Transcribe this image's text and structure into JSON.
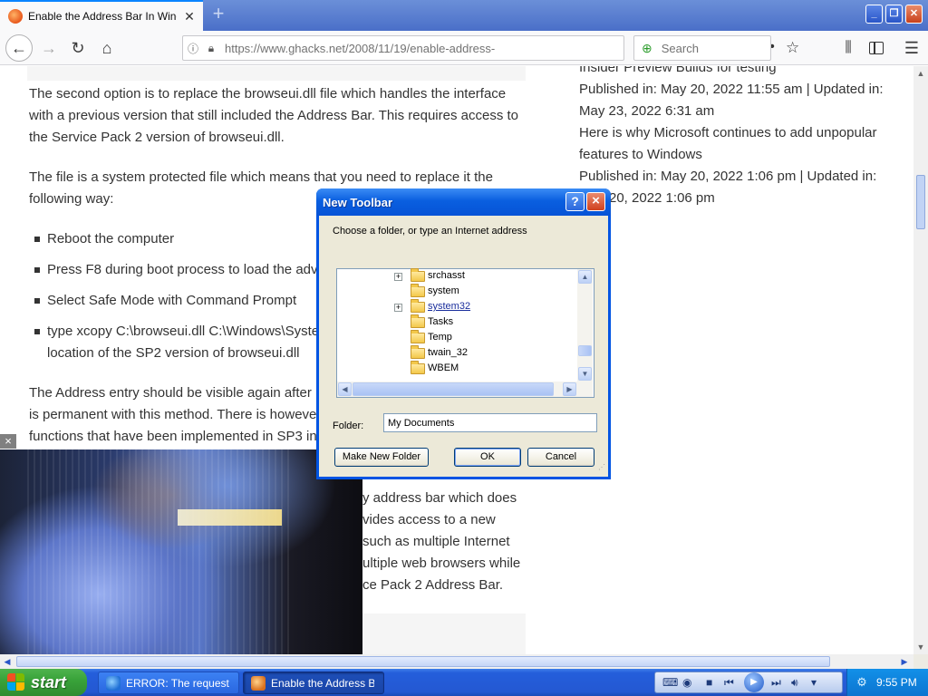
{
  "browser": {
    "tab_title": "Enable the Address Bar In Windows",
    "new_tab_symbol": "+",
    "url_domain": "https://www.ghacks.net",
    "url_path": "/2008/11/19/enable-address-",
    "search_placeholder": "Search"
  },
  "article": {
    "paragraphs": [
      "The second option is to replace the browseui.dll file which handles the interface with a previous version that still included the Address Bar. This requires access to the Service Pack 2 version of browseui.dll.",
      "The file is a system protected file which means that you need to replace it the following way:",
      "The Address entry should be visible again after re",
      "is permanent with this method. There is however",
      "functions that have been implemented in SP3 in t"
    ],
    "bullets": [
      "Reboot the computer",
      "Press F8 during boot process to load the adva",
      "Select Safe Mode with Command Prompt",
      "type xcopy C:\\browseui.dll C:\\Windows\\Syster",
      "location of the SP2 version of browseui.dll"
    ],
    "tail_lines": [
      "y address bar which does",
      "vides access to a new",
      "such as multiple Internet",
      "ultiple web browsers while",
      "ce Pack 2 Address Bar."
    ]
  },
  "sidebar": {
    "lines": [
      "Insider Preview Builds for testing",
      "Published in: May 20, 2022 11:55 am | Updated in:",
      "May 23, 2022 6:31 am",
      "Here is why Microsoft continues to add unpopular",
      "features to Windows",
      "Published in: May 20, 2022 1:06 pm | Updated in:",
      "20, 2022 1:06 pm"
    ]
  },
  "video": {
    "close_symbol": "×"
  },
  "dialog": {
    "title": "New Toolbar",
    "help_symbol": "?",
    "close_symbol": "×",
    "prompt": "Choose a folder, or type an Internet address",
    "tree_items": [
      {
        "label": "srchasst",
        "expandable": true
      },
      {
        "label": "system",
        "expandable": false
      },
      {
        "label": "system32",
        "expandable": true
      },
      {
        "label": "Tasks",
        "expandable": false
      },
      {
        "label": "Temp",
        "expandable": false
      },
      {
        "label": "twain_32",
        "expandable": false
      },
      {
        "label": "WBEM",
        "expandable": false
      }
    ],
    "folder_label": "Folder:",
    "folder_value": "My Documents",
    "buttons": {
      "new_folder": "Make New Folder",
      "ok": "OK",
      "cancel": "Cancel"
    }
  },
  "taskbar": {
    "start_label": "start",
    "tasks": [
      {
        "label": "ERROR: The request..."
      },
      {
        "label": "Enable the Address B..."
      }
    ],
    "clock": "9:55 PM"
  },
  "icons": {
    "back": "back-arrow-icon",
    "forward": "forward-arrow-icon",
    "reload": "reload-icon",
    "home": "home-icon",
    "library": "library-icon",
    "sidebar": "sidebar-icon",
    "menu": "hamburger-menu-icon",
    "folder": "folder-icon",
    "windows": "windows-logo-icon"
  }
}
